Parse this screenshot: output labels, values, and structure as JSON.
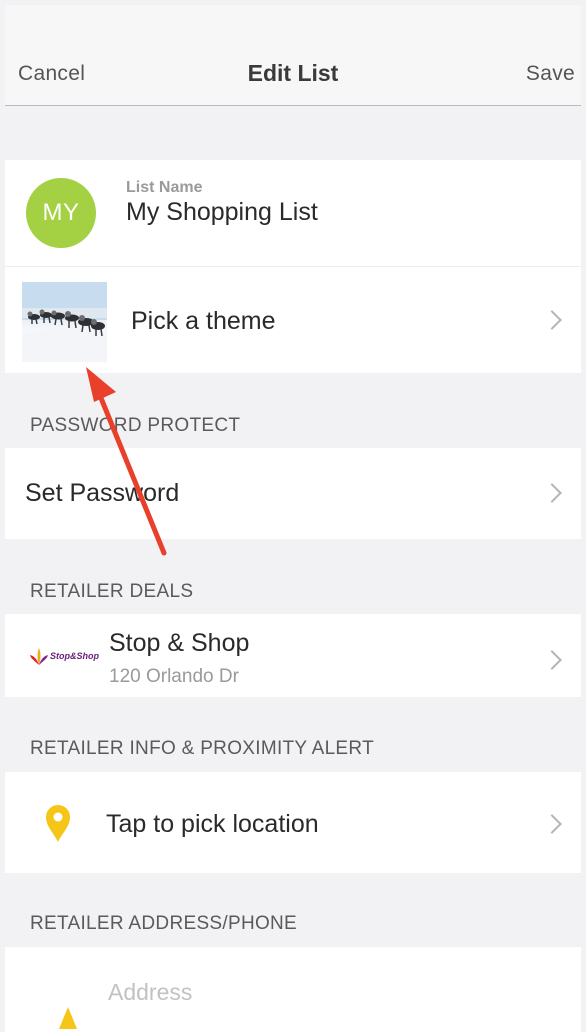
{
  "nav": {
    "cancel": "Cancel",
    "title": "Edit List",
    "save": "Save"
  },
  "list_name": {
    "initials": "MY",
    "label": "List Name",
    "value": "My Shopping List"
  },
  "theme": {
    "label": "Pick a theme"
  },
  "password": {
    "header": "PASSWORD PROTECT",
    "label": "Set Password"
  },
  "deals": {
    "header": "RETAILER DEALS",
    "store": "Stop & Shop",
    "address": "120 Orlando Dr",
    "logo_text": "Stop&Shop"
  },
  "location": {
    "header": "RETAILER INFO & PROXIMITY ALERT",
    "label": "Tap to pick location"
  },
  "address": {
    "header": "RETAILER ADDRESS/PHONE",
    "placeholder": "Address"
  },
  "colors": {
    "avatar": "#a4d144",
    "pin": "#f5c518",
    "annotation_arrow": "#e8402a"
  }
}
